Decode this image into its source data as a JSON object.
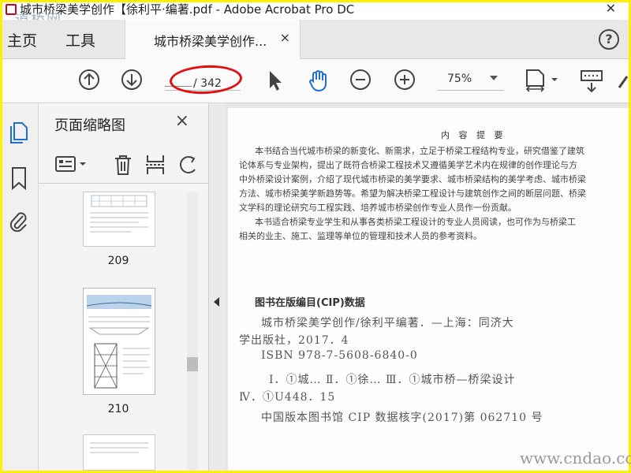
{
  "window": {
    "title": "城市桥梁美学创作【徐利平·编著.pdf - Adobe Acrobat Pro DC",
    "watermark": "道桥网"
  },
  "tabs": {
    "home": "主页",
    "tools": "工具",
    "document": "城市桥梁美学创作...",
    "close_glyph": "×"
  },
  "toolbar": {
    "page_current": "",
    "page_total": "/ 342",
    "zoom": "75%"
  },
  "thumbnail_panel": {
    "title": "页面缩略图",
    "close_glyph": "×",
    "pages": [
      {
        "label": "209"
      },
      {
        "label": "210"
      },
      {
        "label": ""
      }
    ]
  },
  "document": {
    "heading": "内 容 提 要",
    "paragraphs": [
      "本书结合当代城市桥梁的新变化、新需求，立足于桥梁工程结构专业，研究借鉴了建筑",
      "论体系与专业架构，提出了既符合桥梁工程技术又遵循美学艺术内在规律的创作理论与方",
      "中外桥梁设计案例，介绍了现代城市桥梁的美学要求、城市桥梁结构的美学考虑、城市桥梁",
      "方法、城市桥梁美学新趋势等。希望为解决桥梁工程设计与建筑创作之间的断层问题、桥梁",
      "文学科的理论研究与工程实践、培养城市桥梁创作专业人员作一份贡献。",
      "本书适合桥梁专业学生和从事各类桥梁工程设计的专业人员阅读，也可作为与桥梁工",
      "相关的业主、施工、监理等单位的管理和技术人员的参考资料。"
    ],
    "cip_title": "图书在版编目(CIP)数据",
    "cip_lines": [
      "城市桥梁美学创作/徐利平编著．—上海：同济大",
      "学出版社，2017．4",
      "ISBN 978-7-5608-6840-0",
      "Ⅰ．①城…  Ⅱ．①徐…  Ⅲ．①城市桥—桥梁设计",
      "Ⅳ．①U448．15",
      "中国版本图书馆 CIP 数据核字(2017)第 062710 号"
    ],
    "site_watermark": "www.cndao.com"
  },
  "colors": {
    "frame": "#ffef00",
    "annotation": "#e01010",
    "hand_tool": "#1f6fd1",
    "active_rail": "#1f6fd1"
  }
}
